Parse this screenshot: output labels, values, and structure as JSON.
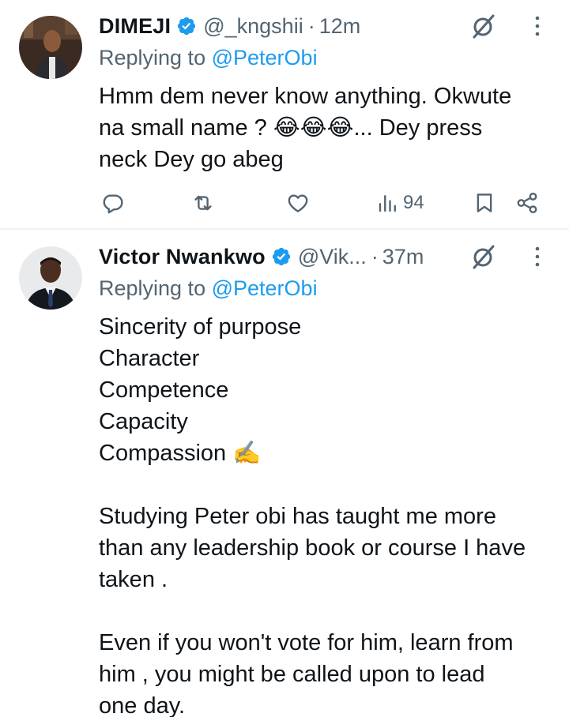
{
  "tweets": [
    {
      "name": "DIMEJI",
      "handle": "@_kngshii",
      "separator": "·",
      "time": "12m",
      "replying_prefix": "Replying to",
      "replying_to": "@PeterObi",
      "text_lines": [
        "Hmm dem never know anything. Okwute",
        "na small name ? 😂😂😂... Dey press",
        "neck Dey go abeg"
      ],
      "views": "94"
    },
    {
      "name": "Victor Nwankwo",
      "handle": "@Vik...",
      "separator": "·",
      "time": "37m",
      "replying_prefix": "Replying to",
      "replying_to": "@PeterObi",
      "text_lines": [
        "Sincerity of purpose",
        "Character",
        "Competence",
        "Capacity",
        "Compassion ✍️",
        "",
        "Studying Peter obi has taught me more",
        "than any leadership book or course I have",
        "taken .",
        "",
        "Even if you won't vote for him, learn from",
        "him , you might be called upon to lead",
        "one day."
      ]
    }
  ],
  "colors": {
    "verified": "#1d9bf0",
    "secondary": "#536471",
    "mention": "#1d9bf0"
  },
  "icons": [
    "verified-badge-icon",
    "grok-icon",
    "more-icon",
    "reply-icon",
    "retweet-icon",
    "like-icon",
    "views-icon",
    "bookmark-icon",
    "share-icon"
  ]
}
